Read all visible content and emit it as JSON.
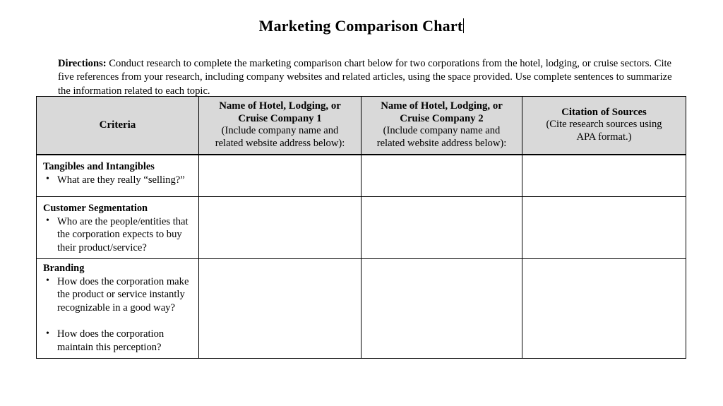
{
  "document": {
    "title": "Marketing Comparison Chart",
    "has_text_caret": true,
    "directions_label": "Directions:",
    "directions_body": " Conduct research to complete the marketing comparison chart below for two corporations from the hotel, lodging, or cruise sectors. Cite five references from your research, including company websites and related articles, using the space provided. Use complete sentences to summarize the information related to each topic."
  },
  "table": {
    "header_background": "#d9d9d9",
    "columns": [
      {
        "id": "criteria",
        "title": "Criteria",
        "subtitle_lines": []
      },
      {
        "id": "company1",
        "title_lines": [
          "Name of Hotel, Lodging, or",
          "Cruise Company 1"
        ],
        "subtitle_lines": [
          "(Include company name and",
          "related website address below):"
        ]
      },
      {
        "id": "company2",
        "title_lines": [
          "Name of Hotel, Lodging, or",
          "Cruise Company 2"
        ],
        "subtitle_lines": [
          "(Include company name and",
          "related website address below):"
        ]
      },
      {
        "id": "citation",
        "title_lines": [
          "Citation of Sources"
        ],
        "subtitle_lines": [
          "(Cite research sources using",
          "APA format.)"
        ]
      }
    ],
    "rows": [
      {
        "criteria_title": "Tangibles and Intangibles",
        "bullets": [
          "What are they really “selling?”"
        ],
        "company1": "",
        "company2": "",
        "citation": ""
      },
      {
        "criteria_title": "Customer Segmentation",
        "bullets": [
          "Who are the people/entities that the corporation expects to buy their product/service?"
        ],
        "company1": "",
        "company2": "",
        "citation": ""
      },
      {
        "criteria_title": "Branding",
        "bullets": [
          "How does the corporation make the product or service instantly recognizable in a good way?",
          "How does the corporation maintain this perception?"
        ],
        "company1": "",
        "company2": "",
        "citation": ""
      }
    ]
  }
}
